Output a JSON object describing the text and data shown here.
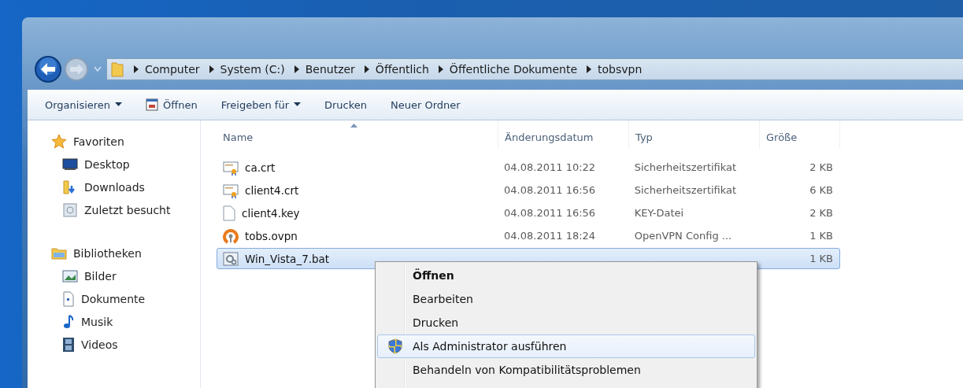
{
  "address_bar": {
    "segments": [
      "Computer",
      "System (C:)",
      "Benutzer",
      "Öffentlich",
      "Öffentliche Dokumente",
      "tobsvpn"
    ]
  },
  "toolbar": [
    {
      "label": "Organisieren",
      "dropdown": true,
      "icon": false
    },
    {
      "label": "Öffnen",
      "dropdown": false,
      "icon": true
    },
    {
      "label": "Freigeben für",
      "dropdown": true,
      "icon": false
    },
    {
      "label": "Drucken",
      "dropdown": false,
      "icon": false
    },
    {
      "label": "Neuer Ordner",
      "dropdown": false,
      "icon": false
    }
  ],
  "sidebar": [
    {
      "label": "Favoriten",
      "kind": "star",
      "children": [
        {
          "label": "Desktop",
          "kind": "desktop"
        },
        {
          "label": "Downloads",
          "kind": "downloads"
        },
        {
          "label": "Zuletzt besucht",
          "kind": "recent"
        }
      ]
    },
    {
      "label": "Bibliotheken",
      "kind": "library",
      "children": [
        {
          "label": "Bilder",
          "kind": "pictures"
        },
        {
          "label": "Dokumente",
          "kind": "documents"
        },
        {
          "label": "Musik",
          "kind": "music"
        },
        {
          "label": "Videos",
          "kind": "videos"
        }
      ]
    }
  ],
  "table": {
    "columns": [
      "Name",
      "Änderungsdatum",
      "Typ",
      "Größe"
    ],
    "rows": [
      {
        "name": "ca.crt",
        "kind": "cert",
        "date": "04.08.2011 10:22",
        "type": "Sicherheitszertifikat",
        "size": "2 KB",
        "selected": false
      },
      {
        "name": "client4.crt",
        "kind": "cert",
        "date": "04.08.2011 16:56",
        "type": "Sicherheitszertifikat",
        "size": "6 KB",
        "selected": false
      },
      {
        "name": "client4.key",
        "kind": "file",
        "date": "04.08.2011 16:56",
        "type": "KEY-Datei",
        "size": "2 KB",
        "selected": false
      },
      {
        "name": "tobs.ovpn",
        "kind": "ovpn",
        "date": "04.08.2011 18:24",
        "type": "OpenVPN Config ...",
        "size": "1 KB",
        "selected": false
      },
      {
        "name": "Win_Vista_7.bat",
        "kind": "bat",
        "size": "1 KB",
        "selected": true
      }
    ]
  },
  "context_menu": [
    {
      "label": "Öffnen",
      "bold": true,
      "shield": false,
      "selected": false
    },
    {
      "label": "Bearbeiten",
      "bold": false,
      "shield": false,
      "selected": false
    },
    {
      "label": "Drucken",
      "bold": false,
      "shield": false,
      "selected": false
    },
    {
      "label": "Als Administrator ausführen",
      "bold": false,
      "shield": true,
      "selected": true
    },
    {
      "label": "Behandeln von Kompatibilitätsproblemen",
      "bold": false,
      "shield": false,
      "selected": false
    }
  ]
}
